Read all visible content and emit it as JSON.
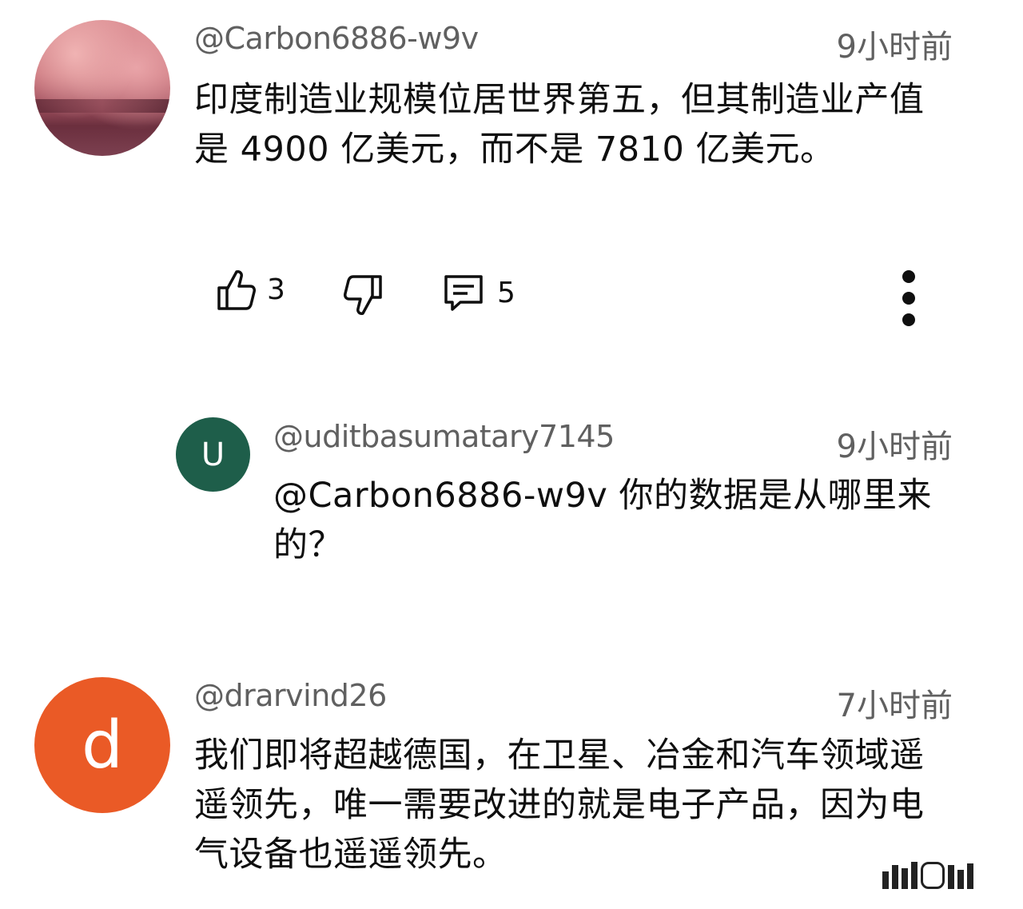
{
  "comments": [
    {
      "author": "@Carbon6886-w9v",
      "time": "9小时前",
      "text": "印度制造业规模位居世界第五，但其制造业产值是 4900 亿美元，而不是 7810 亿美元。",
      "likes": "3",
      "replies": "5"
    },
    {
      "author": "@uditbasumatary7145",
      "time": "9小时前",
      "avatar_letter": "U",
      "avatar_color": "#1e5e4a",
      "text": "@Carbon6886-w9v 你的数据是从哪里来的？"
    },
    {
      "author": "@drarvind26",
      "time": "7小时前",
      "avatar_letter": "d",
      "avatar_color": "#ea5a26",
      "text": "我们即将超越德国，在卫星、冶金和汽车领域遥遥领先，唯一需要改进的就是电子产品，因为电气设备也遥遥领先。"
    }
  ],
  "icons": {
    "like": "thumbs-up-icon",
    "dislike": "thumbs-down-icon",
    "reply": "comment-icon",
    "more": "more-vertical-icon"
  }
}
